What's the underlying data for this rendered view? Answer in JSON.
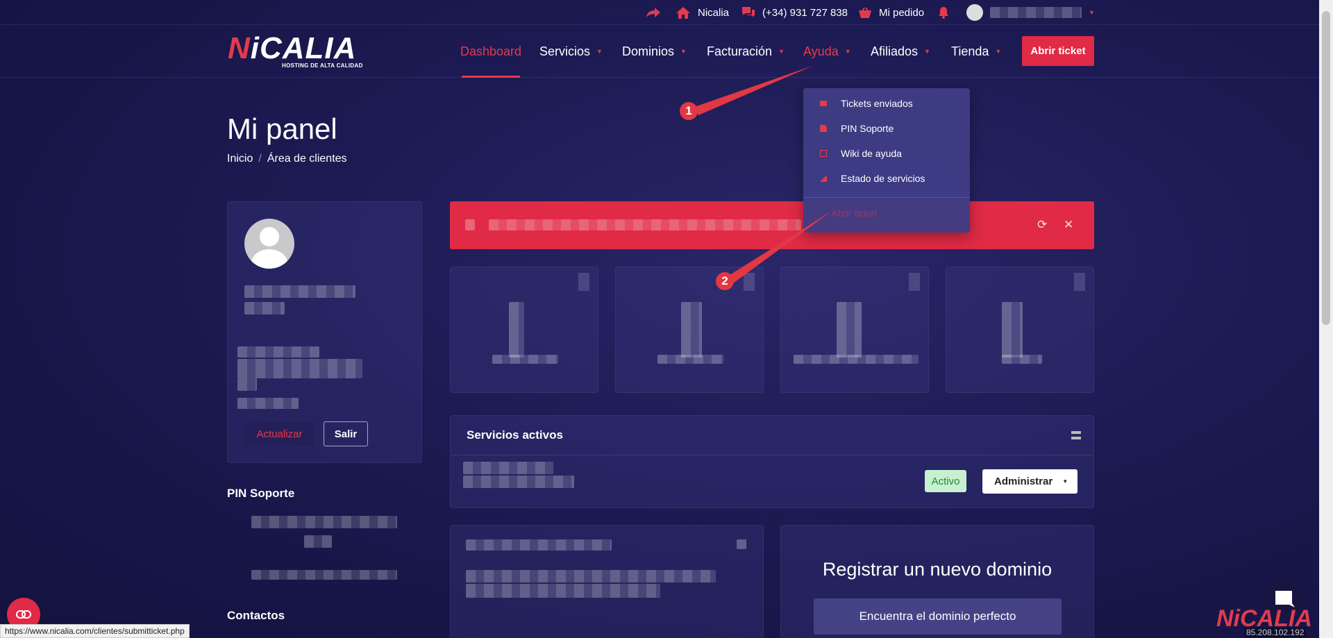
{
  "topbar": {
    "brand_label": "Nicalia",
    "phone": "(+34) 931 727 838",
    "order_label": "Mi pedido"
  },
  "logo": {
    "text_n": "N",
    "text_rest": "iCALIA",
    "tagline": "HOSTING DE ALTA CALIDAD"
  },
  "nav": {
    "items": [
      "Dashboard",
      "Servicios",
      "Dominios",
      "Facturación",
      "Ayuda",
      "Afiliados",
      "Tienda"
    ],
    "ticket_button": "Abrir ticket"
  },
  "page": {
    "title": "Mi panel",
    "breadcrumb": [
      "Inicio",
      "Área de clientes"
    ]
  },
  "profile": {
    "update_button": "Actualizar",
    "logout_button": "Salir"
  },
  "sidebar": {
    "pin_heading": "PIN Soporte",
    "contacts_heading": "Contactos"
  },
  "services": {
    "heading": "Servicios activos",
    "status": "Activo",
    "manage_button": "Administrar"
  },
  "domain": {
    "heading": "Registrar un nuevo dominio",
    "search_placeholder": "Encuentra el dominio perfecto"
  },
  "dropdown": {
    "items": [
      "Tickets enviados",
      "PIN Soporte",
      "Wiki de ayuda",
      "Estado de servicios"
    ],
    "last": "Abrir ticket"
  },
  "markers": [
    "1",
    "2"
  ],
  "status_url": "https://www.nicalia.com/clientes/submitticket.php",
  "ip": "85.208.102.192",
  "corner_logo": "NiCALIA",
  "colors": {
    "accent": "#e12a45",
    "background": "#1c1a52"
  }
}
